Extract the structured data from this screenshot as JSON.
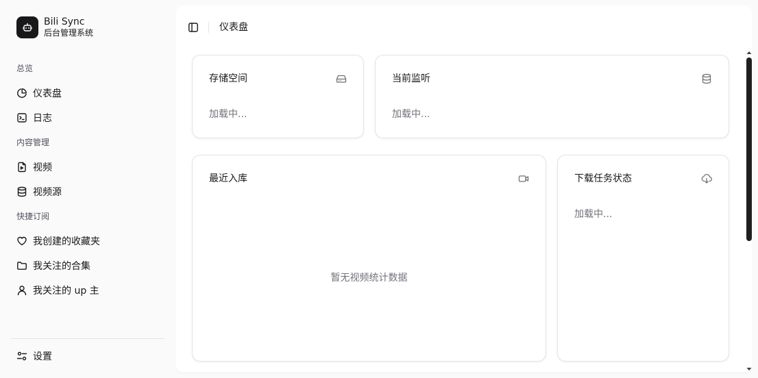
{
  "brand": {
    "name": "Bili Sync",
    "subtitle": "后台管理系统"
  },
  "sidebar": {
    "groups": [
      {
        "label": "总览"
      },
      {
        "label": "内容管理"
      },
      {
        "label": "快捷订阅"
      }
    ],
    "items": [
      {
        "label": "仪表盘",
        "icon": "pie-chart-icon"
      },
      {
        "label": "日志",
        "icon": "terminal-icon"
      },
      {
        "label": "视频",
        "icon": "video-file-icon"
      },
      {
        "label": "视频源",
        "icon": "database-icon"
      },
      {
        "label": "我创建的收藏夹",
        "icon": "heart-icon"
      },
      {
        "label": "我关注的合集",
        "icon": "folder-icon"
      },
      {
        "label": "我关注的 up 主",
        "icon": "user-icon"
      }
    ],
    "settings": {
      "label": "设置",
      "icon": "sliders-icon"
    }
  },
  "header": {
    "title": "仪表盘"
  },
  "cards": {
    "storage": {
      "title": "存储空间",
      "status": "加载中...",
      "icon": "hard-drive-icon"
    },
    "monitor": {
      "title": "当前监听",
      "status": "加载中...",
      "icon": "database-icon"
    },
    "recent": {
      "title": "最近入库",
      "empty": "暂无视频统计数据",
      "icon": "video-camera-icon"
    },
    "download": {
      "title": "下载任务状态",
      "status": "加载中...",
      "icon": "cloud-download-icon"
    }
  }
}
